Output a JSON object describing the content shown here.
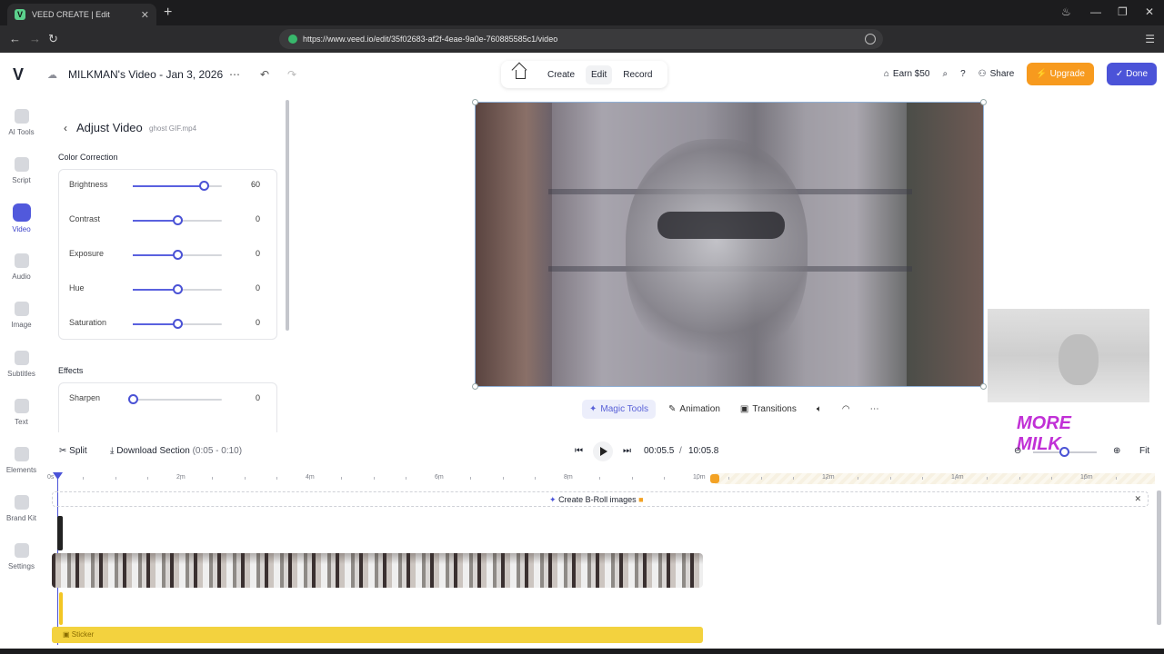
{
  "browser": {
    "tab_title": "VEED CREATE | Edit",
    "tab_favicon": "V",
    "url": "https://www.veed.io/edit/35f02683-af2f-4eae-9a0e-760885585c1/video"
  },
  "header": {
    "logo": "V",
    "project_title": "MILKMAN's Video - Jan 3, 2026",
    "nav": [
      "Create",
      "Edit",
      "Record"
    ],
    "active_nav": "Edit",
    "earn": "Earn $50",
    "share": "Share",
    "upgrade": "Upgrade",
    "done": "Done"
  },
  "rail": [
    {
      "label": "AI Tools",
      "icon": "ai-tools-icon"
    },
    {
      "label": "Script",
      "icon": "script-icon"
    },
    {
      "label": "Video",
      "icon": "video-icon",
      "active": true
    },
    {
      "label": "Audio",
      "icon": "audio-icon"
    },
    {
      "label": "Image",
      "icon": "image-icon"
    },
    {
      "label": "Subtitles",
      "icon": "subtitles-icon"
    },
    {
      "label": "Text",
      "icon": "text-icon"
    },
    {
      "label": "Elements",
      "icon": "elements-icon"
    },
    {
      "label": "Brand Kit",
      "icon": "brand-kit-icon"
    },
    {
      "label": "Settings",
      "icon": "settings-icon"
    }
  ],
  "panel": {
    "title": "Adjust Video",
    "file": "ghost GIF.mp4",
    "color_section": "Color Correction",
    "color_rows": [
      {
        "label": "Brightness",
        "value": "60",
        "level": 0.8
      },
      {
        "label": "Contrast",
        "value": "0",
        "level": 0.5
      },
      {
        "label": "Exposure",
        "value": "0",
        "level": 0.5
      },
      {
        "label": "Hue",
        "value": "0",
        "level": 0.5
      },
      {
        "label": "Saturation",
        "value": "0",
        "level": 0.5
      }
    ],
    "effects_section": "Effects",
    "effects_rows": [
      {
        "label": "Sharpen",
        "value": "0",
        "level": 0.0
      }
    ]
  },
  "preview_tools": [
    "Magic Tools",
    "Animation",
    "Transitions"
  ],
  "timeline": {
    "split": "Split",
    "download": "Download Section",
    "download_range": "(0:05 - 0:10)",
    "current_time": "00:05.5",
    "separator": "/",
    "total_time": "10:05.8",
    "fit": "Fit",
    "ruler_labels": [
      "0s",
      "2m",
      "4m",
      "6m",
      "8m",
      "10m",
      "12m",
      "14m",
      "16m"
    ],
    "broll": "Create B-Roll images",
    "sticker": "Sticker"
  },
  "overlay": {
    "sticker_text": "MORE MILK"
  },
  "colors": {
    "accent": "#4b53d8",
    "upgrade": "#f79a1e",
    "sticker": "#f3d23e"
  }
}
